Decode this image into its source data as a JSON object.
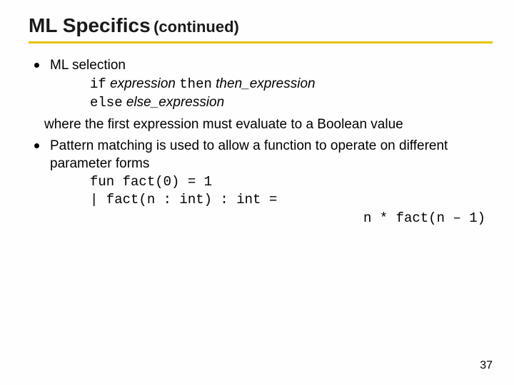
{
  "title": "ML Specifics",
  "title_suffix": "(continued)",
  "bullets": {
    "item1": {
      "lead": "ML selection",
      "code_line1_kw_if": "if",
      "code_line1_expr": " expression ",
      "code_line1_kw_then": "then",
      "code_line1_thenexpr": " then_expression",
      "code_line2_kw_else": "else",
      "code_line2_elseexpr": " else_expression",
      "where": "where the first expression must evaluate to a Boolean value"
    },
    "item2": {
      "lead": "Pattern matching is used to allow a function to operate on different parameter forms",
      "code_line1": "fun fact(0) = 1",
      "code_line2": "|     fact(n : int) : int =",
      "code_line3": "n * fact(n – 1)"
    }
  },
  "page_number": "37"
}
